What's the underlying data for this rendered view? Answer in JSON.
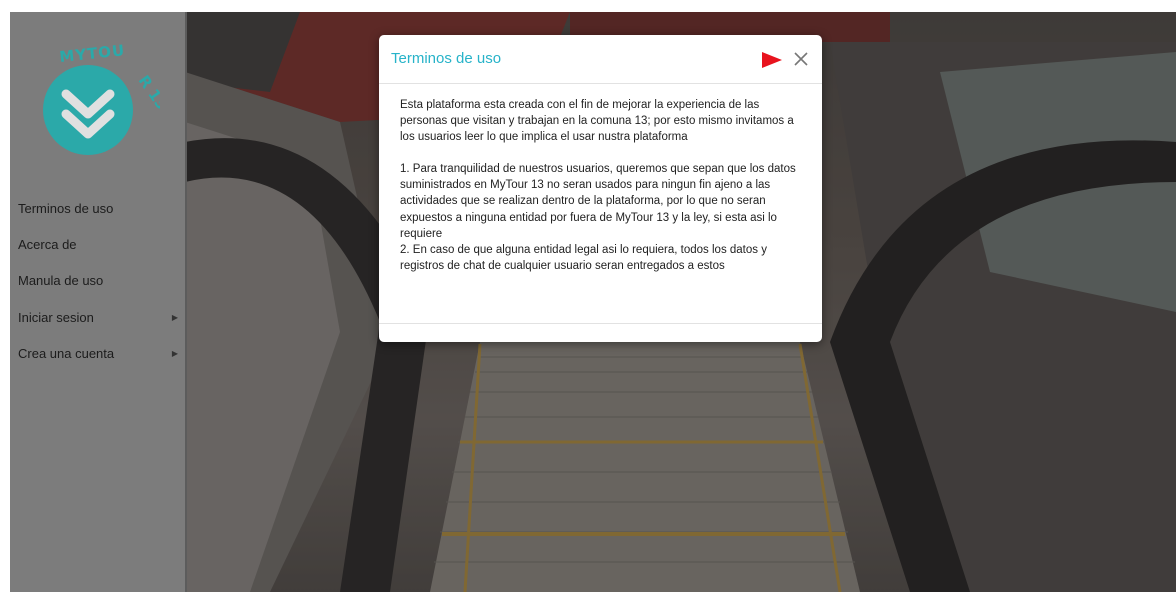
{
  "sidebar": {
    "logo_text": "MYTOUR 13",
    "items": [
      {
        "label": "Terminos de uso",
        "has_submenu": false
      },
      {
        "label": "Acerca de",
        "has_submenu": false
      },
      {
        "label": "Manula de uso",
        "has_submenu": false
      },
      {
        "label": "Iniciar sesion",
        "has_submenu": true
      },
      {
        "label": "Crea una cuenta",
        "has_submenu": true
      }
    ]
  },
  "modal": {
    "title": "Terminos de uso",
    "flag_icon": "flag-icon",
    "close_icon": "close-icon",
    "intro": "Esta plataforma esta creada con el fin de mejorar la experiencia de las personas que visitan y trabajan en la comuna 13; por esto mismo invitamos a los usuarios leer lo que implica el usar nustra plataforma",
    "term_1": "1. Para tranquilidad de nuestros usuarios, queremos que sepan que los datos suministrados en MyTour 13 no seran usados para ningun fin ajeno a las actividades que se realizan dentro de la plataforma, por lo que no seran expuestos a ninguna entidad por fuera de MyTour 13 y la ley, si esta asi lo requiere",
    "term_2": "2. En caso de que alguna entidad legal asi lo requiera, todos los datos y registros de chat de cualquier usuario seran entregados a estos"
  },
  "colors": {
    "accent": "#27b3c9",
    "flag": "#e8131e",
    "sidebar_bg": "#7c7c7c",
    "logo_teal": "#2ba9a9"
  }
}
